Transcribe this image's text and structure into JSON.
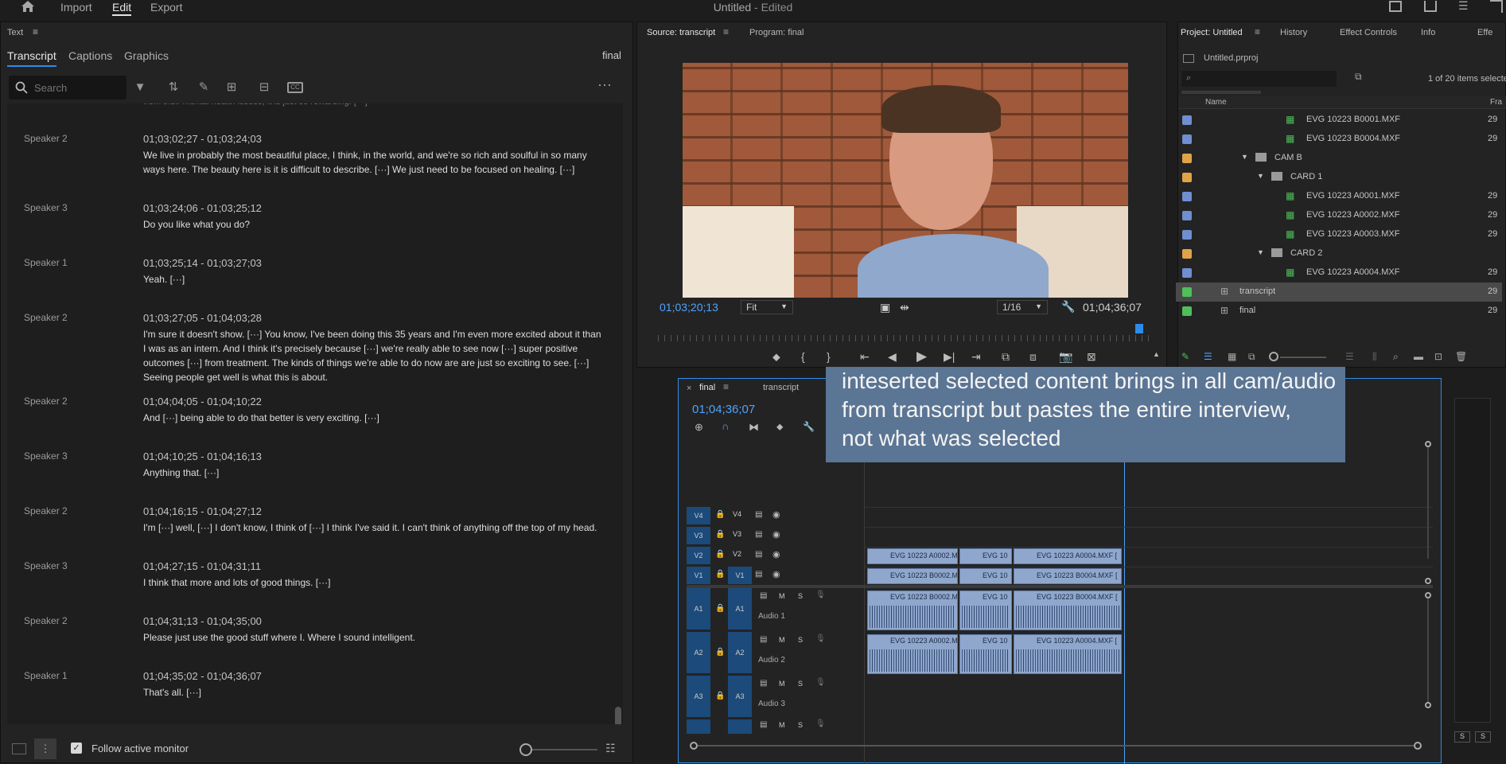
{
  "app": {
    "title": "Untitled",
    "edited": "- Edited",
    "nav": [
      "Import",
      "Edit",
      "Export"
    ]
  },
  "text_panel": {
    "title": "Text",
    "tabs": [
      "Transcript",
      "Captions",
      "Graphics"
    ],
    "sequence": "final",
    "search_placeholder": "Search",
    "follow_label": "Follow active monitor",
    "entries": [
      {
        "speaker": "Speaker 2",
        "tc": "01;03;02;27 - 01;03;24;03",
        "text": "We live in probably the most beautiful place, I think, in the world, and we're so rich and soulful in so many ways here. The beauty here is it is difficult to describe. [···] We just need to be focused on healing. [···]"
      },
      {
        "speaker": "Speaker 3",
        "tc": "01;03;24;06 - 01;03;25;12",
        "text": "Do you like what you do?"
      },
      {
        "speaker": "Speaker 1",
        "tc": "01;03;25;14 - 01;03;27;03",
        "text": "Yeah. [···]"
      },
      {
        "speaker": "Speaker 2",
        "tc": "01;03;27;05 - 01;04;03;28",
        "text": "I'm sure it doesn't show. [···] You know, I've been doing this 35 years and I'm even more excited about it than I was as an intern. And I think it's precisely because [···] we're really able to see now [···] super positive outcomes [···] from treatment. The kinds of things we're able to do now are are just so exciting to see. [···] Seeing people get well is what this is about."
      },
      {
        "speaker": "Speaker 2",
        "tc": "01;04;04;05 - 01;04;10;22",
        "text": "And [···] being able to do that better is very exciting. [···]"
      },
      {
        "speaker": "Speaker 3",
        "tc": "01;04;10;25 - 01;04;16;13",
        "text": "Anything that. [···]"
      },
      {
        "speaker": "Speaker 2",
        "tc": "01;04;16;15 - 01;04;27;12",
        "text": "I'm [···] well, [···] I don't know, I think of [···] I think I've said it. I can't think of anything off the top of my head."
      },
      {
        "speaker": "Speaker 3",
        "tc": "01;04;27;15 - 01;04;31;11",
        "text": "I think that more and lots of good things. [···]"
      },
      {
        "speaker": "Speaker 2",
        "tc": "01;04;31;13 - 01;04;35;00",
        "text": "Please just use the good stuff where I. Where I sound intelligent."
      },
      {
        "speaker": "Speaker 1",
        "tc": "01;04;35;02 - 01;04;36;07",
        "text": "That's all. [···]"
      }
    ]
  },
  "source_monitor": {
    "tab_source": "Source: transcript",
    "tab_program": "Program: final",
    "timecode": "01;03;20;13",
    "fit": "Fit",
    "resolution": "1/16",
    "duration": "01;04;36;07"
  },
  "project": {
    "tabs": [
      "Project: Untitled",
      "History",
      "Effect Controls",
      "Info",
      "Effe"
    ],
    "file": "Untitled.prproj",
    "count": "1 of 20 items selecte",
    "col_name": "Name",
    "col_fr": "Fra",
    "rows": [
      {
        "name": "EVG 10223 B0001.MXF",
        "fr": "29",
        "color": "#6f8fd1",
        "indent": 1
      },
      {
        "name": "EVG 10223 B0004.MXF",
        "fr": "29",
        "color": "#6f8fd1",
        "indent": 1
      },
      {
        "name": "CAM B",
        "fr": "",
        "color": "#e0a347",
        "indent": 2
      },
      {
        "name": "CARD 1",
        "fr": "",
        "color": "#e0a347",
        "indent": 3
      },
      {
        "name": "EVG 10223 A0001.MXF",
        "fr": "29",
        "color": "#6f8fd1",
        "indent": 1
      },
      {
        "name": "EVG 10223 A0002.MXF",
        "fr": "29",
        "color": "#6f8fd1",
        "indent": 1
      },
      {
        "name": "EVG 10223 A0003.MXF",
        "fr": "29",
        "color": "#6f8fd1",
        "indent": 1
      },
      {
        "name": "CARD 2",
        "fr": "",
        "color": "#e0a347",
        "indent": 3
      },
      {
        "name": "EVG 10223 A0004.MXF",
        "fr": "29",
        "color": "#6f8fd1",
        "indent": 1
      },
      {
        "name": "transcript",
        "fr": "29",
        "color": "#4fbf5a",
        "indent": 0
      },
      {
        "name": "final",
        "fr": "29",
        "color": "#4fbf5a",
        "indent": 0
      }
    ]
  },
  "timeline": {
    "tab_final": "final",
    "tab_transcript": "transcript",
    "timecode": "01;04;36;07",
    "tracks": [
      "V4",
      "V3",
      "V2",
      "V1",
      "A1",
      "A2",
      "A3"
    ],
    "audio_names": [
      "Audio 1",
      "Audio 2",
      "Audio 3"
    ],
    "m": "M",
    "s": "S",
    "clips_v2": [
      "EVG 10223 A0002.M",
      "EVG 10",
      "EVG 10223 A0004.MXF ["
    ],
    "clips_v1": [
      "EVG 10223 B0002.M",
      "EVG 10",
      "EVG 10223 B0004.MXF ["
    ],
    "clips_a1": [
      "EVG 10223 B0002.M",
      "EVG 10",
      "EVG 10223 B0004.MXF ["
    ],
    "clips_a2": [
      "EVG 10223 A0002.M",
      "EVG 10",
      "EVG 10223 A0004.MXF ["
    ]
  },
  "annotation": {
    "lines": [
      "inteserted selected content brings in all cam/audio",
      "from transcript but pastes the entire interview,",
      "not what was selected"
    ]
  }
}
